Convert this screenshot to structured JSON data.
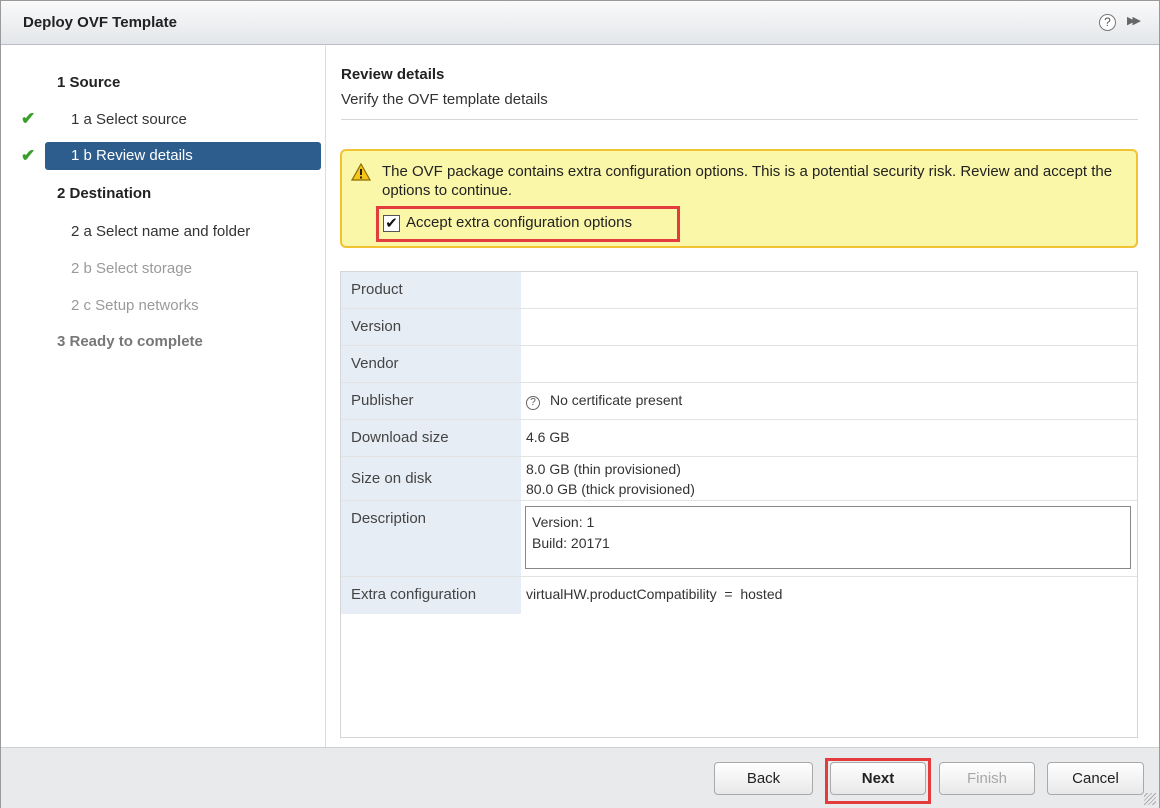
{
  "window": {
    "title": "Deploy OVF Template"
  },
  "header_icons": {
    "help": "question-circle-icon",
    "expand": "double-chevron-right-icon"
  },
  "steps": [
    {
      "label": "1 Source",
      "type": "heading",
      "state": "normal",
      "completed": false
    },
    {
      "label": "1 a  Select source",
      "type": "sub",
      "state": "normal",
      "completed": true
    },
    {
      "label": "1 b  Review details",
      "type": "sub",
      "state": "active",
      "completed": true
    },
    {
      "label": "2 Destination",
      "type": "heading",
      "state": "normal",
      "completed": false
    },
    {
      "label": "2 a  Select name and folder",
      "type": "sub",
      "state": "normal",
      "completed": false
    },
    {
      "label": "2 b  Select storage",
      "type": "sub",
      "state": "disabled",
      "completed": false
    },
    {
      "label": "2 c  Setup networks",
      "type": "sub",
      "state": "disabled",
      "completed": false
    },
    {
      "label": "3 Ready to complete",
      "type": "heading",
      "state": "disabled",
      "completed": false
    }
  ],
  "main": {
    "title": "Review details",
    "subtitle": "Verify the OVF template details",
    "warning": {
      "text": "The OVF package contains extra configuration options. This is a potential security risk. Review and accept the options to continue.",
      "checkbox_label": "Accept extra configuration options",
      "checked": true
    },
    "details": {
      "product": {
        "label": "Product",
        "value": ""
      },
      "version": {
        "label": "Version",
        "value": ""
      },
      "vendor": {
        "label": "Vendor",
        "value": ""
      },
      "publisher": {
        "label": "Publisher",
        "value": "No certificate present"
      },
      "download_size": {
        "label": "Download size",
        "value": "4.6 GB"
      },
      "size_on_disk": {
        "label": "Size on disk",
        "line1": "8.0 GB (thin provisioned)",
        "line2": "80.0 GB (thick provisioned)"
      },
      "description": {
        "label": "Description",
        "line1": "Version: 1",
        "line2": "Build: 20171"
      },
      "extra_configuration": {
        "label": "Extra configuration",
        "value": "virtualHW.productCompatibility  =  hosted"
      }
    }
  },
  "footer": {
    "back": "Back",
    "next": "Next",
    "finish": "Finish",
    "cancel": "Cancel"
  },
  "colors": {
    "active_step": "#2d5d8c",
    "check": "#3a9f2a",
    "warning_bg": "#fbf7a9",
    "warning_border": "#f1c232",
    "highlight": "#e23c3c",
    "label_cell": "#e6edf4"
  }
}
